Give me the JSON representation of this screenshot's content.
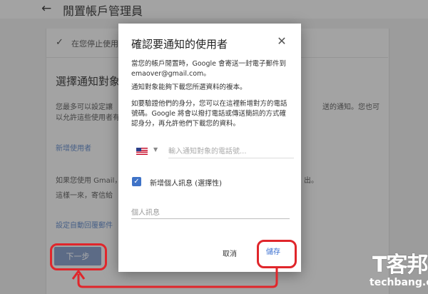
{
  "background": {
    "title": "閒置帳戶管理員",
    "notice": "在您停止使用",
    "section_heading": "選擇通知對象",
    "text_line1a": "您最多可以設定讓",
    "text_line1b": "送的通知。您也可",
    "text_line2a": "以允許這些使用者有",
    "add_user_link": "新增使用者",
    "gmail_line": "如果您使用 Gmail，",
    "gmail_line_end": "出。",
    "gmail_line2": "這樣一來，寄信給",
    "auto_reply_link": "設定自動回覆郵件",
    "next_button": "下一步"
  },
  "dialog": {
    "title": "確認要通知的使用者",
    "close_icon": "✕",
    "para1": "當您的帳戶閒置時，Google 會寄送一封電子郵件到 emaover@gmail.com。",
    "para2": "通知對象能夠下載您所選資料的複本。",
    "para3": "如要驗證他們的身分，您可以在這裡新增對方的電話號碼。Google 將會以撥打電話或傳送簡訊的方式確認身分，再允許他們下載您的資料。",
    "phone_placeholder": "輸入通知對象的電話號...",
    "country_flag": "us-flag",
    "add_message_label": "新增個人訊息 (選擇性)",
    "message_placeholder": "個人訊息",
    "cancel_button": "取消",
    "save_button": "儲存"
  },
  "watermark": {
    "logo": "T客邦",
    "text": "techbang.com"
  },
  "colors": {
    "accent_blue": "#3f73c7",
    "annotation_red": "#e0262b"
  }
}
